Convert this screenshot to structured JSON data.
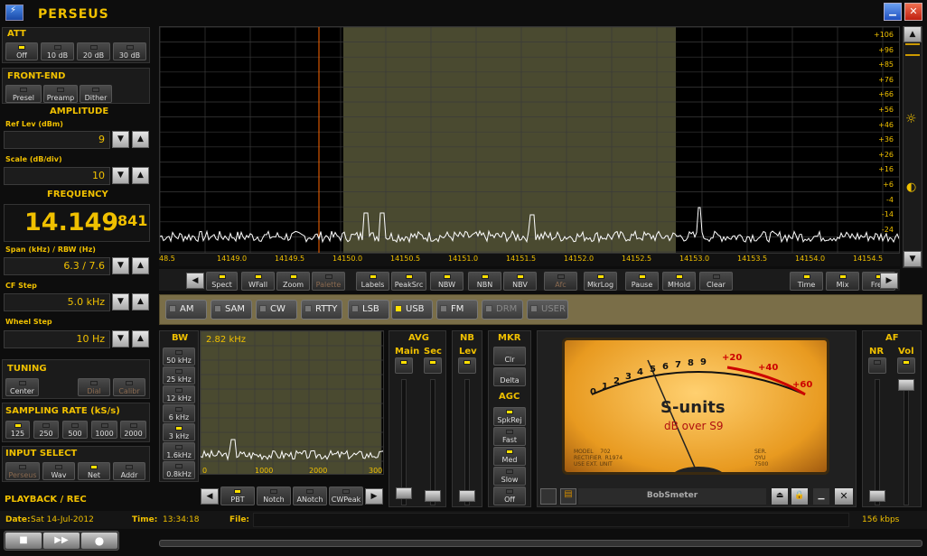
{
  "app": {
    "title": "PERSEUS"
  },
  "att": {
    "title": "ATT",
    "buttons": [
      "Off",
      "10 dB",
      "20 dB",
      "30 dB"
    ],
    "active": 0
  },
  "frontend": {
    "title": "FRONT-END",
    "buttons": [
      "Presel",
      "Preamp",
      "Dither"
    ]
  },
  "amplitude": {
    "title": "AMPLITUDE",
    "ref_label": "Ref Lev (dBm)",
    "ref_value": "9",
    "scale_label": "Scale (dB/div)",
    "scale_value": "10"
  },
  "frequency": {
    "title": "FREQUENCY",
    "main": "14.149",
    "fine": "841",
    "span_label": "Span (kHz) / RBW (Hz)",
    "span_value": "6.3 / 7.6",
    "cf_label": "CF Step",
    "cf_value": "5.0 kHz",
    "wheel_label": "Wheel Step",
    "wheel_value": "10 Hz"
  },
  "tuning": {
    "title": "TUNING",
    "buttons": [
      "Center",
      "Dial",
      "Calibr"
    ]
  },
  "sampling": {
    "title": "SAMPLING RATE (kS/s)",
    "buttons": [
      "125",
      "250",
      "500",
      "1000",
      "2000"
    ]
  },
  "input": {
    "title": "INPUT SELECT",
    "buttons": [
      "Perseus",
      "Wav",
      "Net",
      "Addr"
    ]
  },
  "playback": {
    "title": "PLAYBACK / REC"
  },
  "spectrum": {
    "y_ticks": [
      "+106",
      "+96",
      "+85",
      "+76",
      "+66",
      "+56",
      "+46",
      "+36",
      "+26",
      "+16",
      "+6",
      "-4",
      "-14",
      "-24"
    ],
    "x_ticks": [
      "48.5",
      "14149.0",
      "14149.5",
      "14150.0",
      "14150.5",
      "14151.0",
      "14151.5",
      "14152.0",
      "14152.5",
      "14153.0",
      "14153.5",
      "14154.0",
      "14154.5"
    ]
  },
  "toolbar": {
    "buttons": [
      "Spect",
      "WFall",
      "Zoom",
      "Palette",
      "Labels",
      "PeakSrc",
      "NBW",
      "NBN",
      "NBV",
      "Afc",
      "MkrLog",
      "Pause",
      "MHold",
      "Clear",
      "Time",
      "Mix",
      "Freq"
    ]
  },
  "modes": {
    "items": [
      "AM",
      "SAM",
      "CW",
      "RTTY",
      "LSB",
      "USB",
      "FM",
      "DRM",
      "USER"
    ],
    "active": "USB"
  },
  "bw": {
    "title": "BW",
    "buttons": [
      "50 kHz",
      "25 kHz",
      "12 kHz",
      "6 kHz",
      "3 kHz",
      "1.6kHz",
      "0.8kHz"
    ],
    "display": "2.82 kHz",
    "x_ticks": [
      "0",
      "1000",
      "2000",
      "300"
    ]
  },
  "filter_buttons": [
    "PBT",
    "Notch",
    "ANotch",
    "CWPeak"
  ],
  "avg": {
    "title": "AVG",
    "main": "Main",
    "sec": "Sec"
  },
  "nb": {
    "title": "NB",
    "lev": "Lev"
  },
  "mkr": {
    "title": "MKR",
    "buttons": [
      "Clr",
      "Delta"
    ]
  },
  "agc": {
    "title": "AGC",
    "buttons": [
      "SpkRej",
      "Fast",
      "Med",
      "Slow",
      "Off"
    ]
  },
  "smeter": {
    "title": "S-units",
    "subtitle": "dB over S9",
    "scale_s": [
      "0",
      "1",
      "2",
      "3",
      "4",
      "5",
      "6",
      "7",
      "8",
      "9"
    ],
    "scale_plus": [
      "+20",
      "+40",
      "+60"
    ],
    "footer_left": "MODEL    702\nRECTIFIER  R1974\nUSE EXT. UNIT",
    "footer_right": "SER.\nOYU\n7500",
    "skin": "BobSmeter"
  },
  "af": {
    "title": "AF",
    "nr": "NR",
    "vol": "Vol"
  },
  "status": {
    "date_label": "Date:",
    "date": "Sat 14-Jul-2012",
    "time_label": "Time:",
    "time": "13:34:18",
    "file_label": "File:",
    "rate": "156 kbps"
  }
}
